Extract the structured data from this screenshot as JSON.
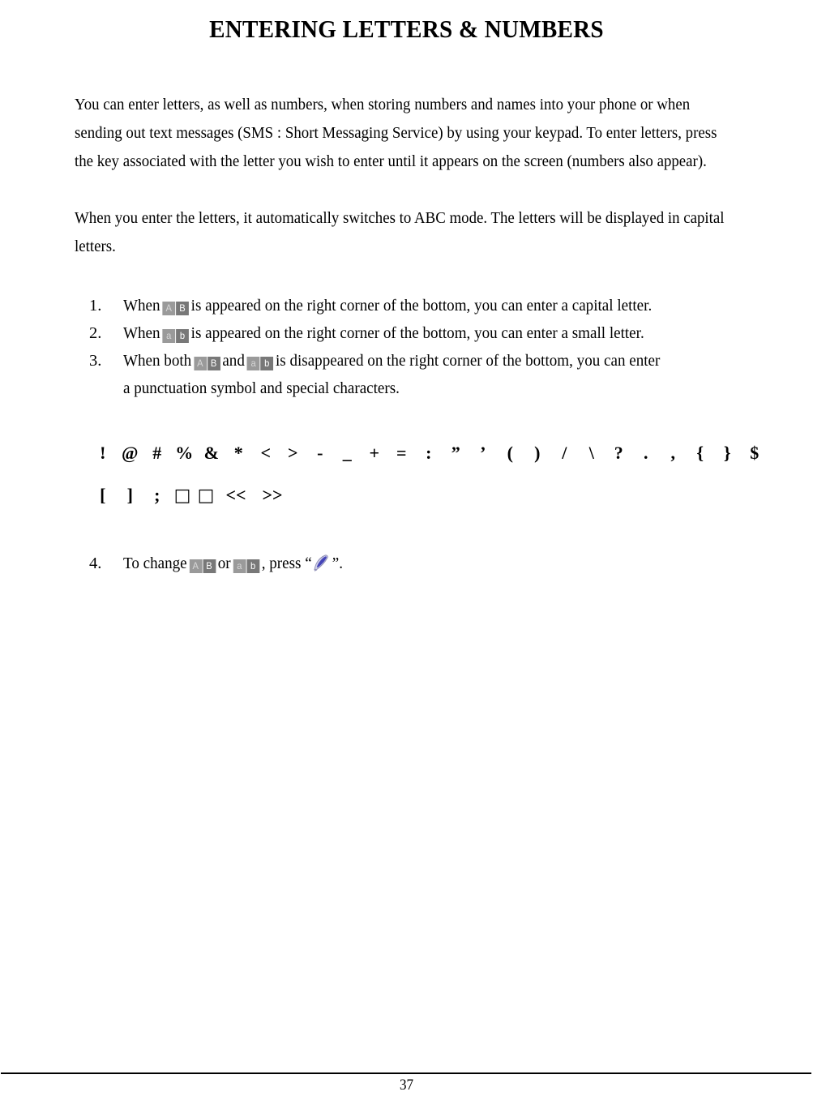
{
  "document": {
    "title": "ENTERING LETTERS & NUMBERS",
    "page_number": "37"
  },
  "paragraphs": {
    "p1": "You can enter letters, as well as numbers, when storing numbers and names into your phone or when sending out text messages (SMS : Short Messaging Service) by using your keypad. To enter letters, press the key associated with the letter you wish to enter until it appears on the screen (numbers also appear).",
    "p2": "When you enter the letters, it automatically switches to ABC mode. The letters will be displayed in capital letters."
  },
  "list": {
    "item1": {
      "number": "1.",
      "before": "When",
      "after": "is appeared on the right corner of the bottom, you can enter a capital letter."
    },
    "item2": {
      "number": "2.",
      "before": "When",
      "after": "is appeared on the right corner of the bottom, you can enter a small letter."
    },
    "item3": {
      "number": "3.",
      "before": "When both",
      "middle": "and",
      "after": "is disappeared on the right corner of the bottom, you can enter",
      "continuation": "a punctuation symbol and special characters."
    },
    "item4": {
      "number": "4.",
      "before": "To change",
      "middle": "or",
      "after": ", press “",
      "end": "”."
    }
  },
  "badges": {
    "uppercase": {
      "left": "A",
      "right": "B",
      "name": "AB-indicator"
    },
    "lowercase": {
      "left": "a",
      "right": "b",
      "name": "ab-indicator"
    },
    "colors": {
      "light_cell": "#9a9a9a",
      "dark_cell": "#787878",
      "light_glyph": "#d8d8d8",
      "dark_glyph": "#ffffff"
    }
  },
  "pen_icon": {
    "name": "pen-stylus-icon",
    "nib_color": "#4646b4",
    "body_color": "#c8c8e6",
    "outline_color": "#8c8cb4"
  },
  "symbol_rows": [
    [
      "!",
      "@",
      "#",
      "%",
      "&",
      "*",
      "<",
      ">",
      "-",
      "_",
      "+",
      "=",
      ":",
      "”",
      "’",
      "(",
      ")",
      "/",
      "\\",
      "?",
      ".",
      ",",
      "{",
      "}",
      "$"
    ],
    [
      "[",
      "]",
      ";",
      "□",
      "□",
      "<<",
      ">>"
    ]
  ]
}
